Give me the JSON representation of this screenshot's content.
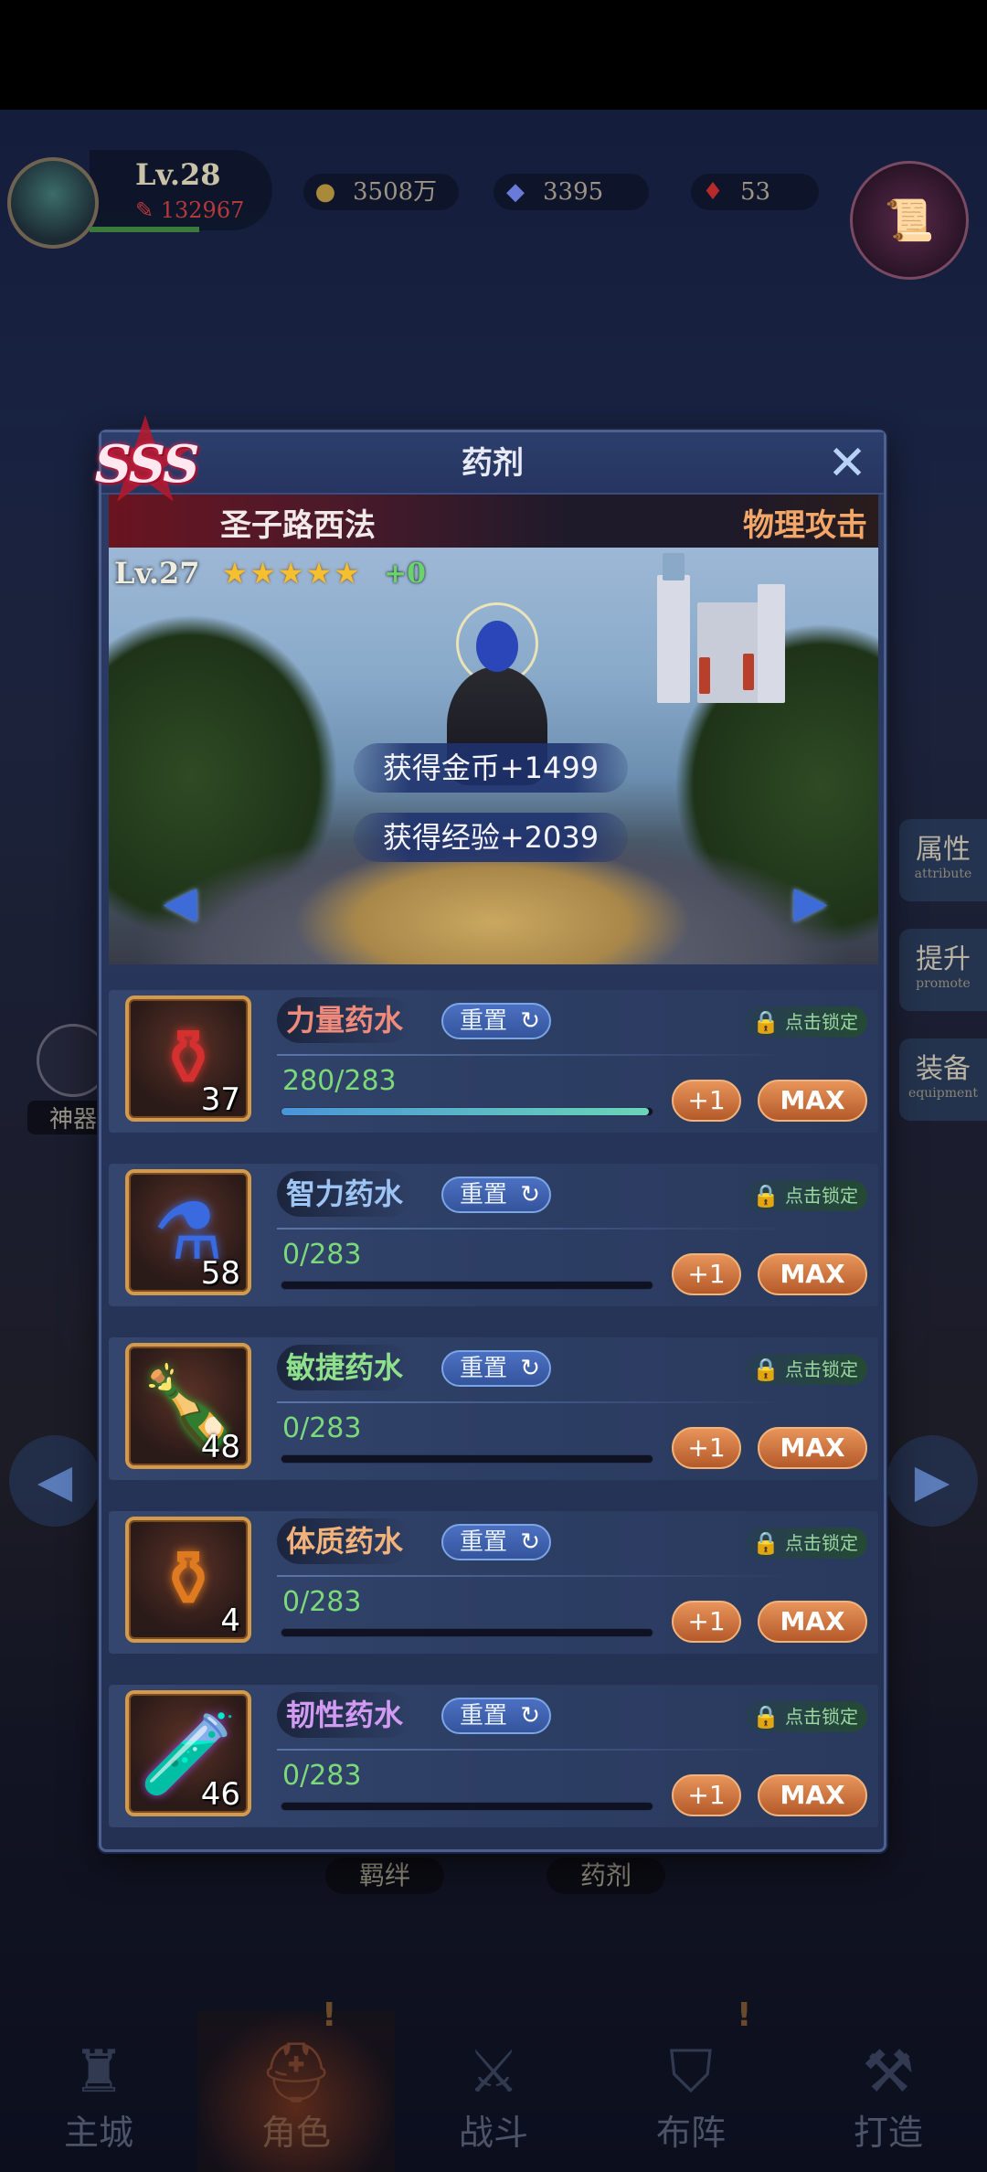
{
  "hud": {
    "level": "Lv.28",
    "power": "132967",
    "gold": "3508万",
    "gems": "3395",
    "rubies": "53"
  },
  "background": {
    "side_buttons": [
      {
        "cn": "属性",
        "en": "attribute"
      },
      {
        "cn": "提升",
        "en": "promote"
      },
      {
        "cn": "装备",
        "en": "equipment"
      }
    ],
    "artifact_label": "神器",
    "tabs": [
      "羁绊",
      "药剂"
    ]
  },
  "bottom_nav": [
    {
      "label": "主城",
      "icon": "castle-icon"
    },
    {
      "label": "角色",
      "icon": "helmet-icon"
    },
    {
      "label": "战斗",
      "icon": "swords-icon"
    },
    {
      "label": "布阵",
      "icon": "formation-icon"
    },
    {
      "label": "打造",
      "icon": "anvil-icon"
    }
  ],
  "panel": {
    "title": "药剂",
    "hero": {
      "rank": "SSS",
      "name": "圣子路西法",
      "type": "物理攻击",
      "level": "Lv.27",
      "stars": "★★★★★",
      "star_count": 5,
      "bonus": "+0"
    },
    "rewards": {
      "gold": "获得金币+1499",
      "exp": "获得经验+2039"
    },
    "potions": [
      {
        "name": "力量药水",
        "name_color": "#f08a7a",
        "count": "37",
        "value": "280/283",
        "progress": 0.989,
        "icon": "red-potion-icon",
        "color": "#d43030"
      },
      {
        "name": "智力药水",
        "name_color": "#9ec4f4",
        "count": "58",
        "value": "0/283",
        "progress": 0,
        "icon": "blue-potion-icon",
        "color": "#3a6ae0"
      },
      {
        "name": "敏捷药水",
        "name_color": "#8ee08a",
        "count": "48",
        "value": "0/283",
        "progress": 0,
        "icon": "green-potion-icon",
        "color": "#3cb838"
      },
      {
        "name": "体质药水",
        "name_color": "#f2b27a",
        "count": "4",
        "value": "0/283",
        "progress": 0,
        "icon": "orange-potion-icon",
        "color": "#e07a20"
      },
      {
        "name": "韧性药水",
        "name_color": "#d29af2",
        "count": "46",
        "value": "0/283",
        "progress": 0,
        "icon": "purple-potion-icon",
        "color": "#9a4ae0"
      }
    ],
    "reset_label": "重置",
    "lock_label": "点击锁定",
    "plus_label": "+1",
    "max_label": "MAX"
  }
}
